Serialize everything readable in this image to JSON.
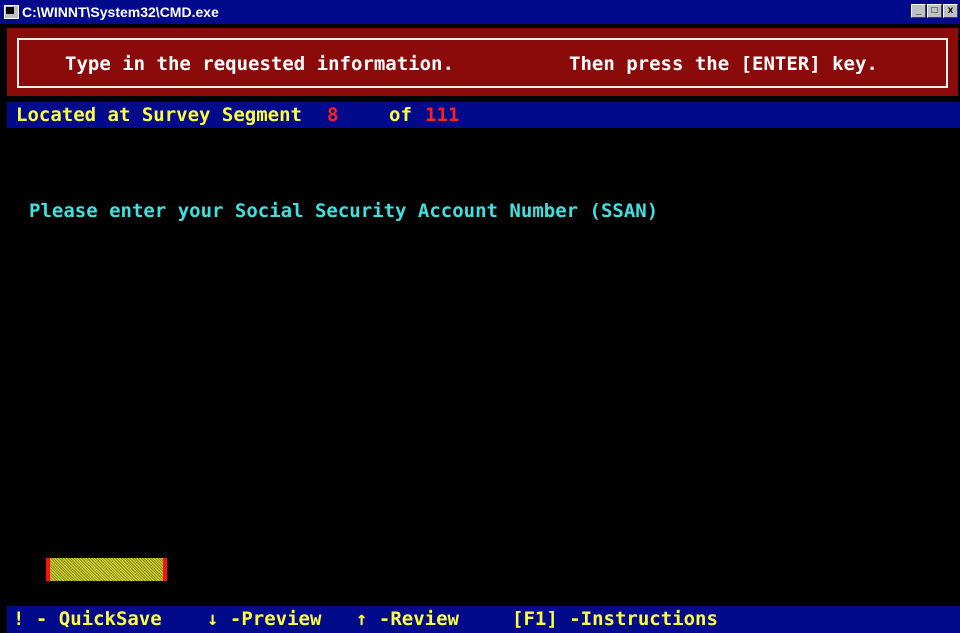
{
  "window": {
    "title": "C:\\WINNT\\System32\\CMD.exe",
    "buttons": {
      "minimize": "_",
      "maximize": "□",
      "close": "x"
    }
  },
  "instructions": {
    "left": "Type in the requested information.",
    "right": "Then press the [ENTER] key."
  },
  "status": {
    "label": "Located at Survey Segment",
    "current": "8",
    "of": "of",
    "total": "111"
  },
  "prompt": "Please enter your Social Security Account Number (SSAN)",
  "input": {
    "value": ""
  },
  "footer": {
    "quicksave": "! - QuickSave",
    "preview": "↓ -Preview",
    "review": "↑ -Review",
    "instructions": "[F1] -Instructions"
  },
  "colors": {
    "title_bar": "#000a8a",
    "instruction_panel": "#8b0a0a",
    "status_text": "#ffff40",
    "segment_numbers": "#ff2020",
    "prompt_text": "#40e0e0"
  }
}
